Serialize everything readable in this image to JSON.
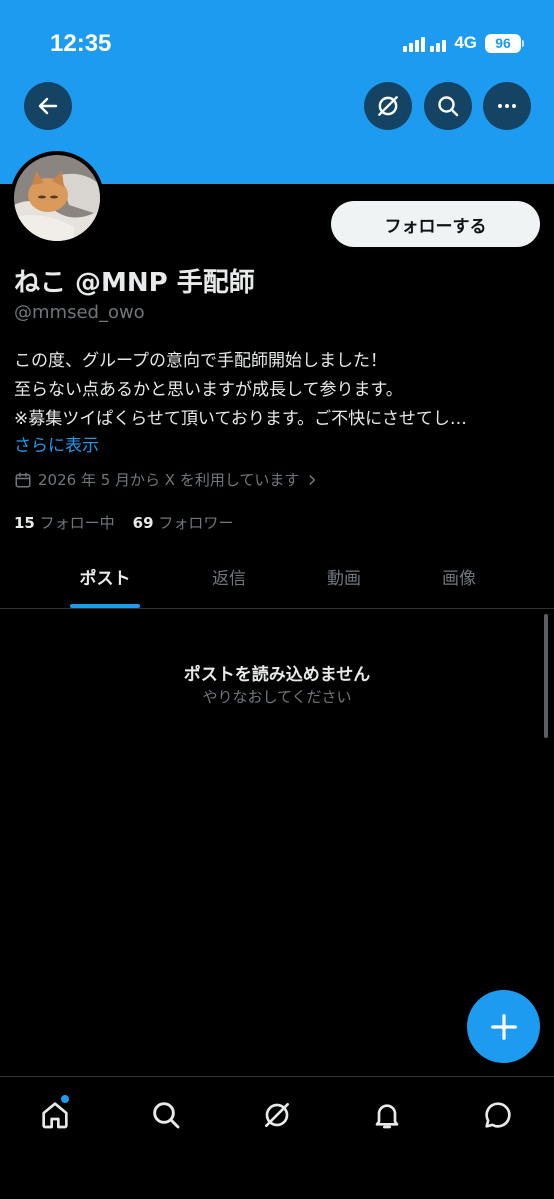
{
  "status_bar": {
    "time": "12:35",
    "network": "4G",
    "battery": "96"
  },
  "colors": {
    "accent": "#1d9bf0",
    "banner": "#1d9bf0",
    "background": "#000000",
    "muted": "#71767b"
  },
  "header": {
    "icons": [
      "back-arrow-icon",
      "grok-icon",
      "search-icon",
      "more-icon"
    ]
  },
  "profile": {
    "display_name": "ねこ @MNP 手配師",
    "handle": "@mmsed_owo",
    "follow_label": "フォローする",
    "bio_lines": [
      "この度、グループの意向で手配師開始しました！",
      "至らない点あるかと思いますが成長して参ります。",
      "※募集ツイぱくらせて頂いております。ご不快にさせてし…"
    ],
    "show_more": "さらに表示",
    "joined": "2026 年 5 月から X を利用しています",
    "following_count": "15",
    "following_label": "フォロー中",
    "followers_count": "69",
    "followers_label": "フォロワー"
  },
  "tabs": [
    {
      "label": "ポスト",
      "active": true
    },
    {
      "label": "返信",
      "active": false
    },
    {
      "label": "動画",
      "active": false
    },
    {
      "label": "画像",
      "active": false
    }
  ],
  "empty_state": {
    "title": "ポストを読み込めません",
    "subtitle": "やりなおしてください"
  },
  "bottom_nav": {
    "icons": [
      "home-icon",
      "search-icon",
      "grok-icon",
      "notifications-icon",
      "messages-icon"
    ]
  }
}
